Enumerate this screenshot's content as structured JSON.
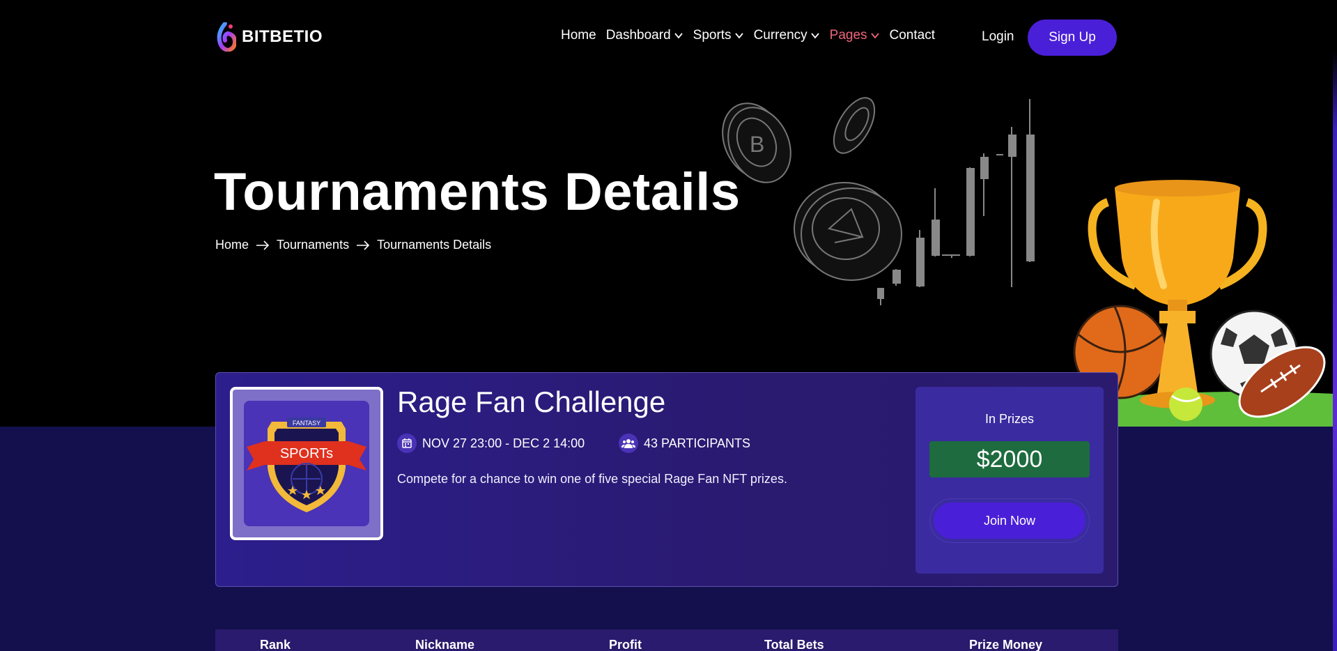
{
  "brand": {
    "name": "BITBETIO"
  },
  "nav": {
    "items": [
      {
        "label": "Home",
        "has_dropdown": false,
        "active": false
      },
      {
        "label": "Dashboard",
        "has_dropdown": true,
        "active": false
      },
      {
        "label": "Sports",
        "has_dropdown": true,
        "active": false
      },
      {
        "label": "Currency",
        "has_dropdown": true,
        "active": false
      },
      {
        "label": "Pages",
        "has_dropdown": true,
        "active": true
      },
      {
        "label": "Contact",
        "has_dropdown": false,
        "active": false
      }
    ],
    "login_label": "Login",
    "signup_label": "Sign Up"
  },
  "hero": {
    "title": "Tournaments Details",
    "breadcrumb": [
      "Home",
      "Tournaments",
      "Tournaments Details"
    ]
  },
  "tournament": {
    "name": "Rage Fan Challenge",
    "dates": "NOV 27 23:00 - DEC 2 14:00",
    "participants": "43 PARTICIPANTS",
    "description": "Compete for a chance to win one of five special Rage Fan NFT prizes.",
    "badge": {
      "top_text": "FANTASY",
      "ribbon_text": "SPORTs"
    },
    "prize_label": "In Prizes",
    "prize_amount": "$2000",
    "join_label": "Join Now"
  },
  "table": {
    "headers": [
      "Rank",
      "Nickname",
      "Profit",
      "Total Bets",
      "Prize Money"
    ]
  },
  "colors": {
    "accent": "#4a1fd8",
    "active_nav": "#f0657a",
    "lower_bg": "#13104d",
    "card_bg": "#2c1e8c",
    "prize_bg": "#1d6b3e"
  },
  "icons": [
    "logo-icon",
    "chevron-down-icon",
    "arrow-right-icon",
    "calendar-icon",
    "users-icon"
  ]
}
